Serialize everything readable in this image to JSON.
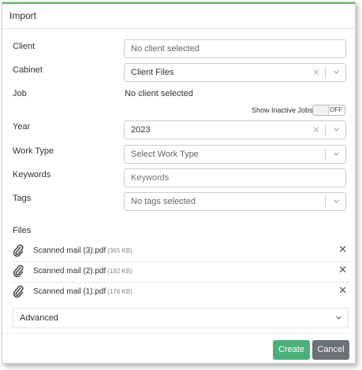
{
  "dialog": {
    "title": "Import",
    "accent_color": "#5cb85c"
  },
  "fields": {
    "client": {
      "label": "Client",
      "placeholder": "No client selected"
    },
    "cabinet": {
      "label": "Cabinet",
      "value": "Client Files"
    },
    "job": {
      "label": "Job",
      "value": "No client selected"
    },
    "show_inactive_jobs": {
      "label": "Show Inactive Jobs",
      "state": "OFF"
    },
    "year": {
      "label": "Year",
      "value": "2023"
    },
    "work_type": {
      "label": "Work Type",
      "placeholder": "Select Work Type"
    },
    "keywords": {
      "label": "Keywords",
      "placeholder": "Keywords"
    },
    "tags": {
      "label": "Tags",
      "placeholder": "No tags selected"
    }
  },
  "files": {
    "label": "Files",
    "items": [
      {
        "name": "Scanned mail (3).pdf",
        "size": "(365 KB)"
      },
      {
        "name": "Scanned mail (2).pdf",
        "size": "(192 KB)"
      },
      {
        "name": "Scanned mail (1).pdf",
        "size": "(176 KB)"
      }
    ],
    "remove_glyph": "✕",
    "icon": "paperclip-icon"
  },
  "advanced": {
    "label": "Advanced"
  },
  "buttons": {
    "create": "Create",
    "cancel": "Cancel",
    "create_color": "#4cb07a",
    "cancel_color": "#6b7177"
  }
}
